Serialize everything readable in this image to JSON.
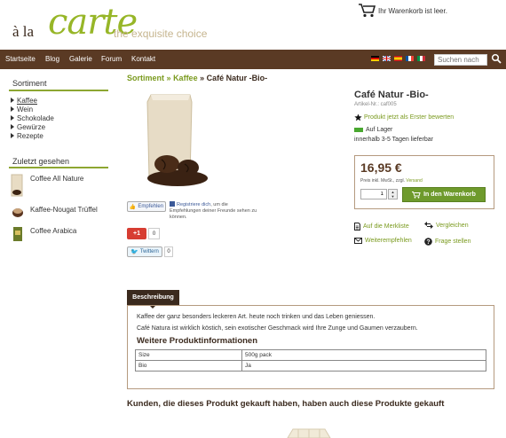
{
  "brand": {
    "prefix": "à la",
    "name": "carte",
    "tagline": "the exquisite choice"
  },
  "cart": {
    "label": "Ihr Warenkorb ist leer."
  },
  "nav": {
    "items": [
      "Startseite",
      "Blog",
      "Galerie",
      "Forum",
      "Kontakt"
    ],
    "search_placeholder": "Suchen nach"
  },
  "sidebar": {
    "assortment_title": "Sortiment",
    "categories": [
      "Kaffee",
      "Wein",
      "Schokolade",
      "Gewürze",
      "Rezepte"
    ],
    "recent_title": "Zuletzt gesehen",
    "recent": [
      "Coffee All Nature",
      "Kaffee-Nougat Trüffel",
      "Coffee Arabica"
    ]
  },
  "breadcrumb": {
    "root": "Sortiment",
    "category": "Kaffee",
    "current": "Café Natur -Bio-",
    "sep": "»"
  },
  "product": {
    "title": "Café Natur -Bio-",
    "sku": "Artikel-Nr.: caf005",
    "rate_label": "Produkt jetzt als Erster bewerten",
    "stock_label": "Auf Lager",
    "delivery": "innerhalb 3-5 Tagen lieferbar",
    "price": "16,95 €",
    "vat_text": "Preis inkl. MwSt., zzgl.",
    "shipping_link": "Versand",
    "quantity": "1",
    "add_to_cart": "In den Warenkorb",
    "wishlist": "Auf die Merkliste",
    "compare": "Vergleichen",
    "recommend": "Weiterempfehlen",
    "ask": "Frage stellen"
  },
  "social": {
    "fb_label": "Empfehlen",
    "fb_link": "Registriere dich",
    "fb_text": ", um die Empfehlungen deiner Freunde sehen zu können.",
    "gplus_label": "+1",
    "gplus_count": "0",
    "twitter_label": "Twittern",
    "twitter_count": "0"
  },
  "description": {
    "tab": "Beschreibung",
    "line1": "Kaffee der ganz besonders leckeren Art. heute noch trinken und das Leben geniessen.",
    "line2": "Café Natura ist wirklich köstich, sein exotischer Geschmack wird Ihre Zunge und Gaumen verzaubern.",
    "more_title": "Weitere Produktinformationen",
    "specs": [
      {
        "key": "Size",
        "value": "500g pack"
      },
      {
        "key": "Bio",
        "value": "Ja"
      }
    ]
  },
  "also_bought_title": "Kunden, die dieses Produkt gekauft haben, haben auch diese Produkte gekauft",
  "colors": {
    "brand_green": "#97b628",
    "nav_brown": "#5a3a24",
    "button_green": "#6e9a2c",
    "link_green": "#7a9a1e"
  }
}
